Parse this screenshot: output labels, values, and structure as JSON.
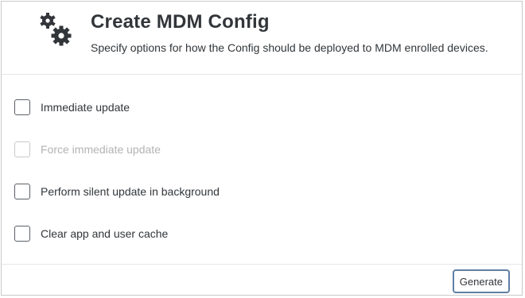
{
  "dialog": {
    "title": "Create MDM Config",
    "subtitle": "Specify options for how the Config should be deployed to MDM enrolled devices.",
    "icon": "gears-icon"
  },
  "options": [
    {
      "label": "Immediate update",
      "checked": false,
      "disabled": false
    },
    {
      "label": "Force immediate update",
      "checked": false,
      "disabled": true
    },
    {
      "label": "Perform silent update in background",
      "checked": false,
      "disabled": false
    },
    {
      "label": "Clear app and user cache",
      "checked": false,
      "disabled": false
    }
  ],
  "footer": {
    "generate_label": "Generate"
  },
  "colors": {
    "text": "#32363a",
    "disabled_text": "#b3b3b3",
    "button_border": "#5f7fa3"
  }
}
